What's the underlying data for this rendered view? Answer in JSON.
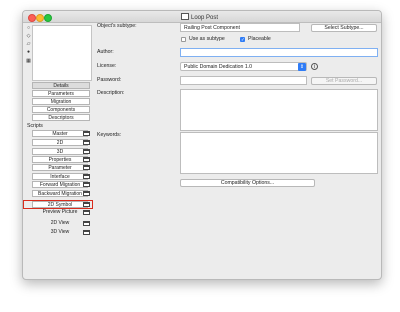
{
  "window": {
    "title": "Loop Post"
  },
  "left_panel": {
    "tabs": [
      "Details",
      "Parameters",
      "Migration",
      "Components",
      "Descriptors"
    ],
    "selected_tab": "Details",
    "scripts_heading": "Scripts",
    "scripts": [
      "Master",
      "2D",
      "3D",
      "Properties",
      "Parameter",
      "Interface",
      "Forward Migration",
      "Backward Migration",
      "2D Symbol"
    ],
    "other_items": [
      "Preview Picture",
      "2D View",
      "3D View"
    ],
    "highlighted_item": "2D Symbol"
  },
  "details": {
    "subtype_label": "Object's subtype:",
    "subtype_value": "Railing Post Component",
    "select_subtype_button": "Select Subtype...",
    "use_as_subtype_label": "Use as subtype",
    "use_as_subtype_checked": false,
    "placeable_label": "Placeable",
    "placeable_checked": true,
    "author_label": "Author:",
    "author_value": "",
    "license_label": "License:",
    "license_value": "Public Domain Dedication 1.0",
    "info_icon": "info-icon",
    "password_label": "Password:",
    "password_value": "",
    "set_password_button": "Set Password...",
    "description_label": "Description:",
    "description_value": "",
    "keywords_label": "Keywords:",
    "keywords_value": "",
    "compat_button": "Compatibility Options..."
  },
  "colors": {
    "accent": "#2f7cf6",
    "highlight": "#d92b1c"
  }
}
